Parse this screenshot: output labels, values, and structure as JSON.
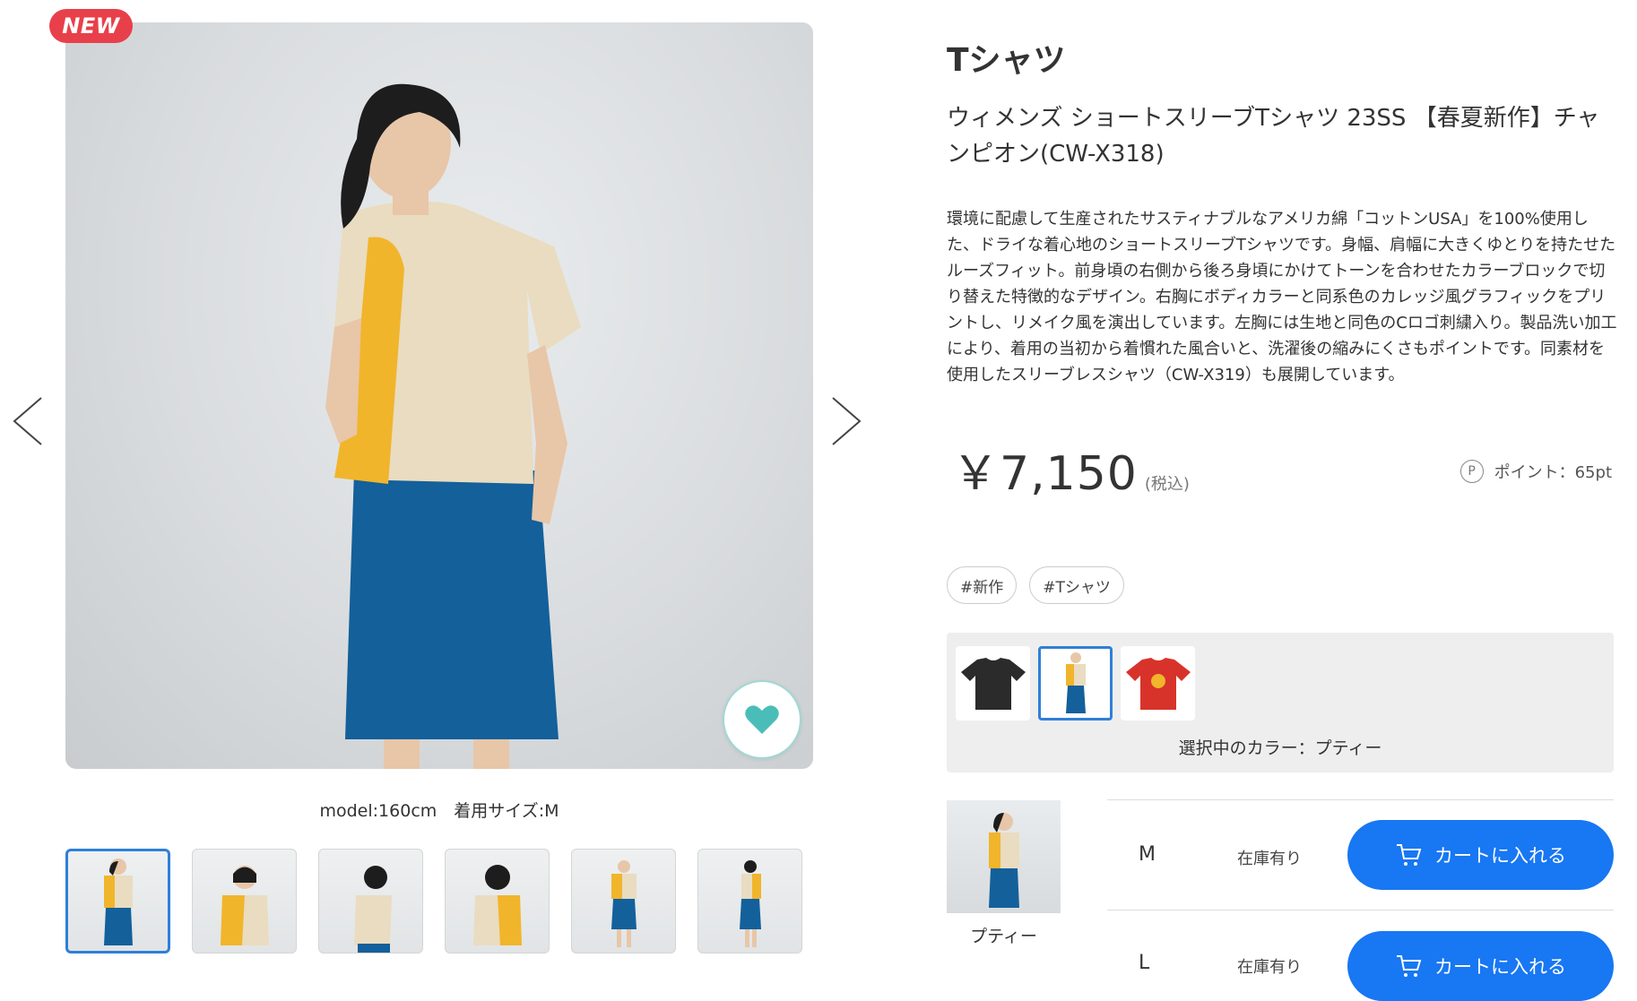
{
  "badge": {
    "new": "NEW"
  },
  "gallery": {
    "model_caption": "model:160cm　着用サイズ:M",
    "thumbnail_count": 6,
    "selected_thumbnail": 1
  },
  "product": {
    "category": "Tシャツ",
    "name": "ウィメンズ ショートスリーブTシャツ 23SS 【春夏新作】チャンピオン(CW-X318)",
    "description": "環境に配慮して生産されたサスティナブルなアメリカ綿「コットンUSA」を100%使用した、ドライな着心地のショートスリーブTシャツです。身幅、肩幅に大きくゆとりを持たせたルーズフィット。前身頃の右側から後ろ身頃にかけてトーンを合わせたカラーブロックで切り替えた特徴的なデザイン。右胸にボディカラーと同系色のカレッジ風グラフィックをプリントし、リメイク風を演出しています。左胸には生地と同色のCロゴ刺繍入り。製品洗い加工により、着用の当初から着慣れた風合いと、洗濯後の縮みにくさもポイントです。同素材を使用したスリーブレスシャツ（CW-X319）も展開しています。",
    "price": "￥7,150",
    "tax_note": "(税込)",
    "points_icon": "P",
    "points": "ポイント：65pt"
  },
  "tags": [
    "#新作",
    "#Tシャツ"
  ],
  "colors": {
    "swatches": [
      {
        "name": "black-tshirt",
        "color": "#2b2b2b"
      },
      {
        "name": "beige-yellow-tshirt",
        "color": "#e9dcc0"
      },
      {
        "name": "red-tshirt",
        "color": "#d8332a"
      }
    ],
    "selected_label": "選択中のカラー：プティー"
  },
  "variant": {
    "name": "プティー"
  },
  "sizes": [
    {
      "size": "M",
      "stock": "在庫有り",
      "button": "カートに入れる"
    },
    {
      "size": "L",
      "stock": "在庫有り",
      "button": "カートに入れる"
    }
  ],
  "accent_colors": {
    "primary": "#1877f2",
    "badge": "#e8404a",
    "heart": "#4bbdb8"
  }
}
